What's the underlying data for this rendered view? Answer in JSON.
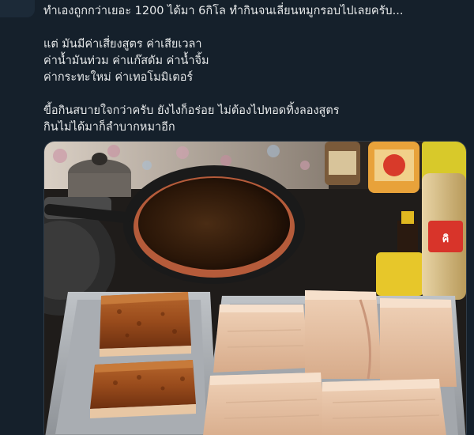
{
  "post": {
    "text": "ทำเองถูกกว่าเยอะ 1200 ได้มา 6กิโล ทำกินจนเลี่ยนหมูกรอบไปเลยครับ...\n\nแต่ มันมีค่าเสี่ยงสูตร ค่าเสียเวลา\nค่าน้ำมันท่วม ค่าแก๊สดัม ค่าน้ำจิ้ม\nค่ากระทะใหม่ ค่าเทอโมมิเตอร์\n\nขี้อกินสบายใจกว่าครับ ยังไงก็อร่อย ไม่ต้องไปทอดทิ้งลองสูตร\nกินไม่ได้มาก็ลำบากหมาอีก"
  },
  "photo": {
    "description_icon": "photo-crispy-pork-kitchen",
    "bottle_label": "คิ"
  },
  "colors": {
    "background": "#15202b",
    "text": "#e7e9ea"
  }
}
